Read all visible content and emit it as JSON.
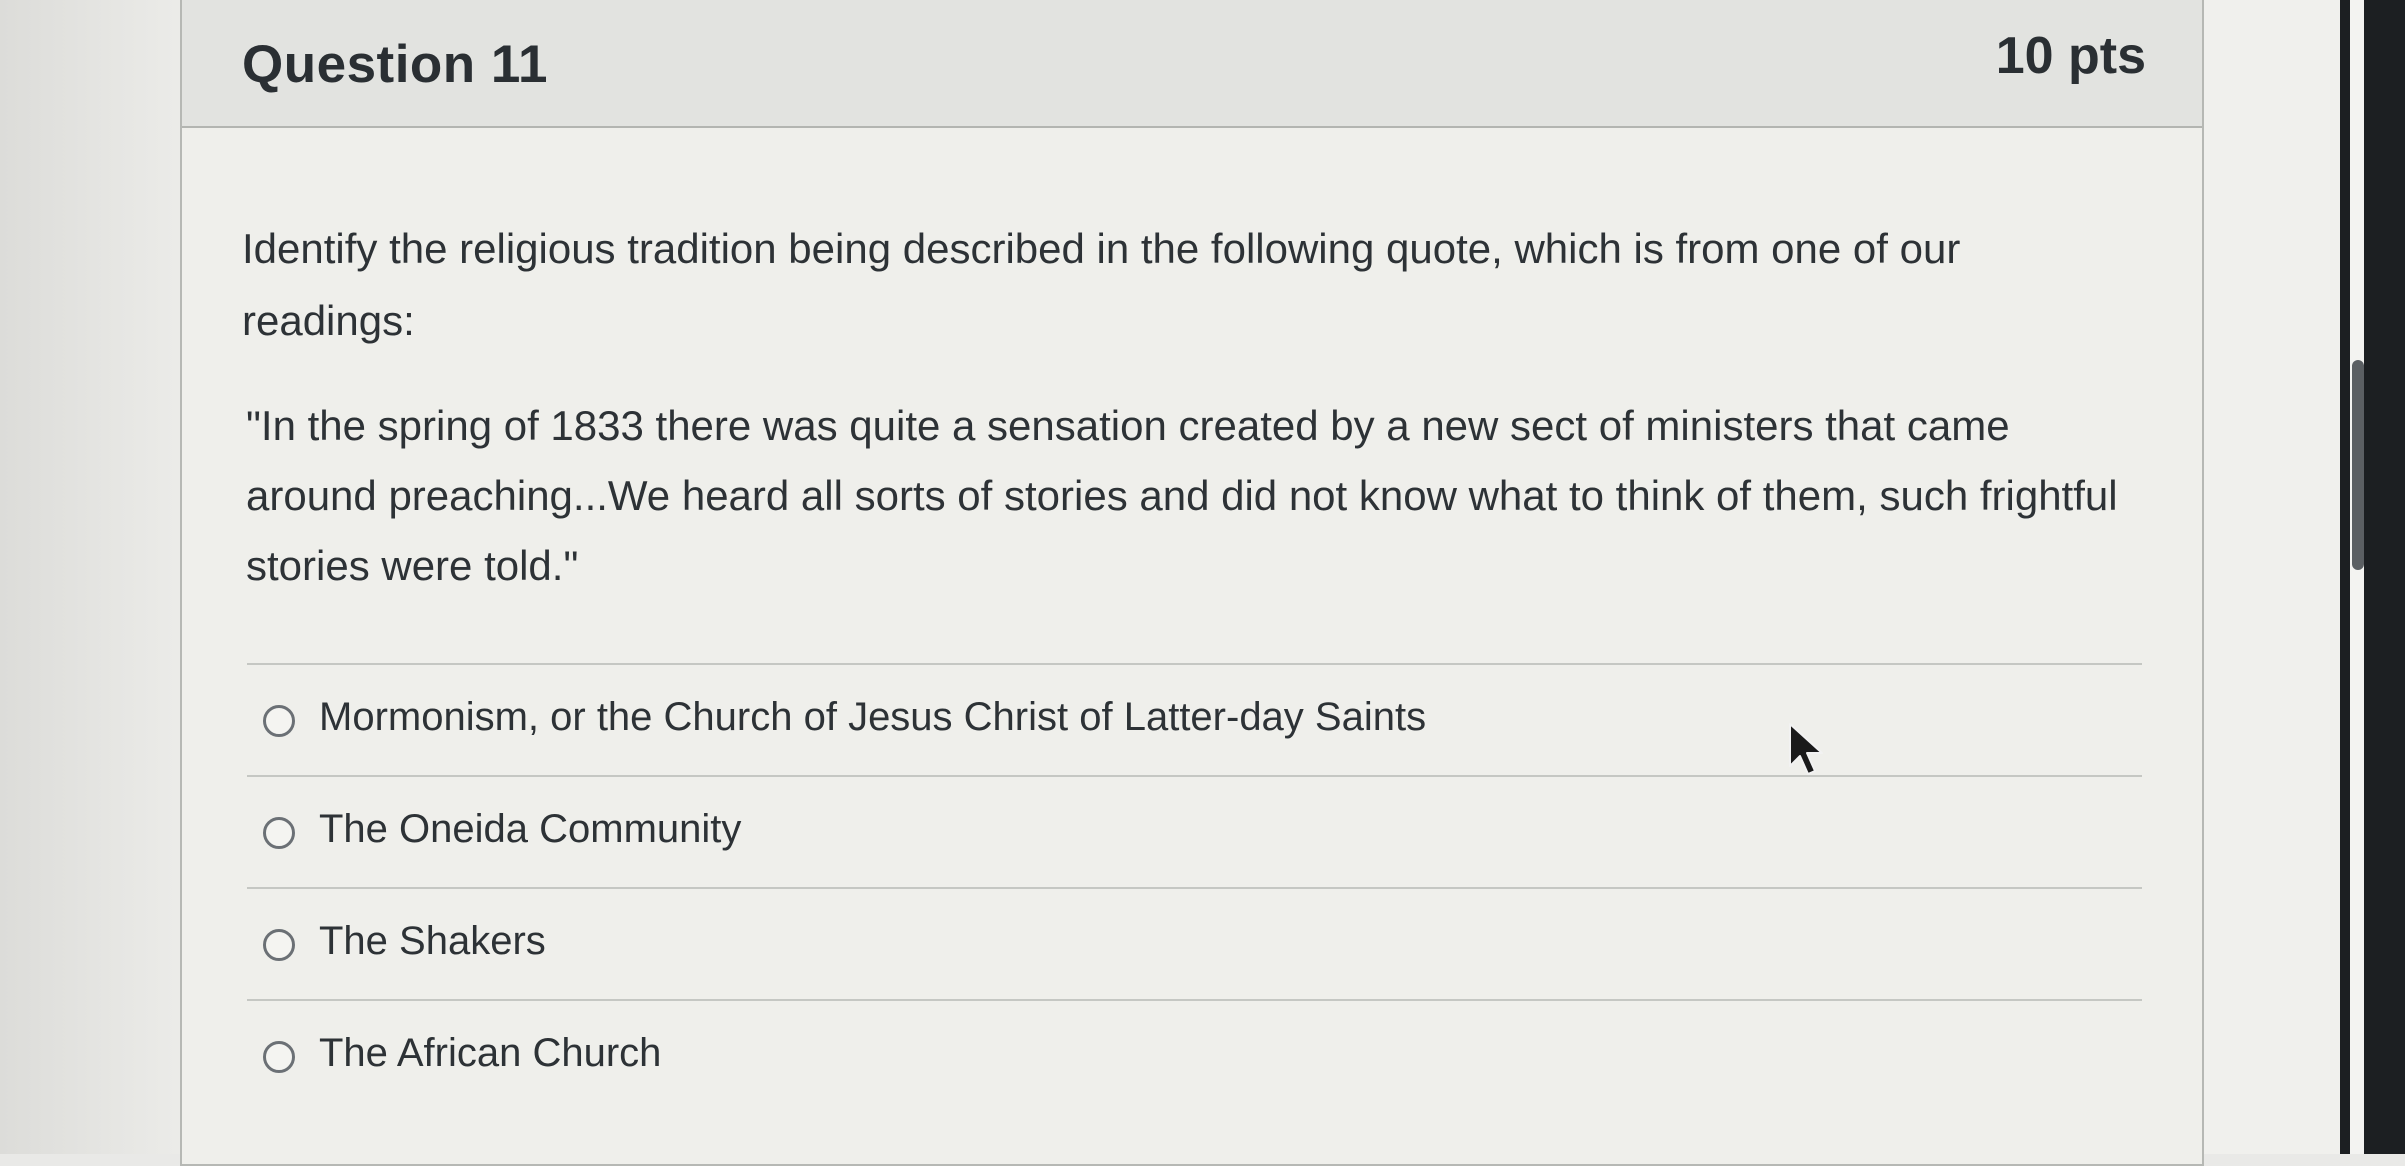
{
  "question": {
    "title": "Question 11",
    "points": "10 pts",
    "prompt": "Identify the religious tradition being described in the following quote, which is from one of our readings:",
    "quote": "\"In the spring of 1833 there was quite a sensation created by a new sect of ministers that came around preaching...We heard all sorts of stories and did not know what to think of them, such frightful stories were told.\""
  },
  "answers": [
    {
      "label": "Mormonism, or the Church of Jesus Christ of Latter-day Saints"
    },
    {
      "label": "The Oneida Community"
    },
    {
      "label": "The Shakers"
    },
    {
      "label": "The African Church"
    }
  ],
  "icons": {
    "cursor": "mouse-pointer-icon",
    "radio": "radio-unselected-icon"
  }
}
